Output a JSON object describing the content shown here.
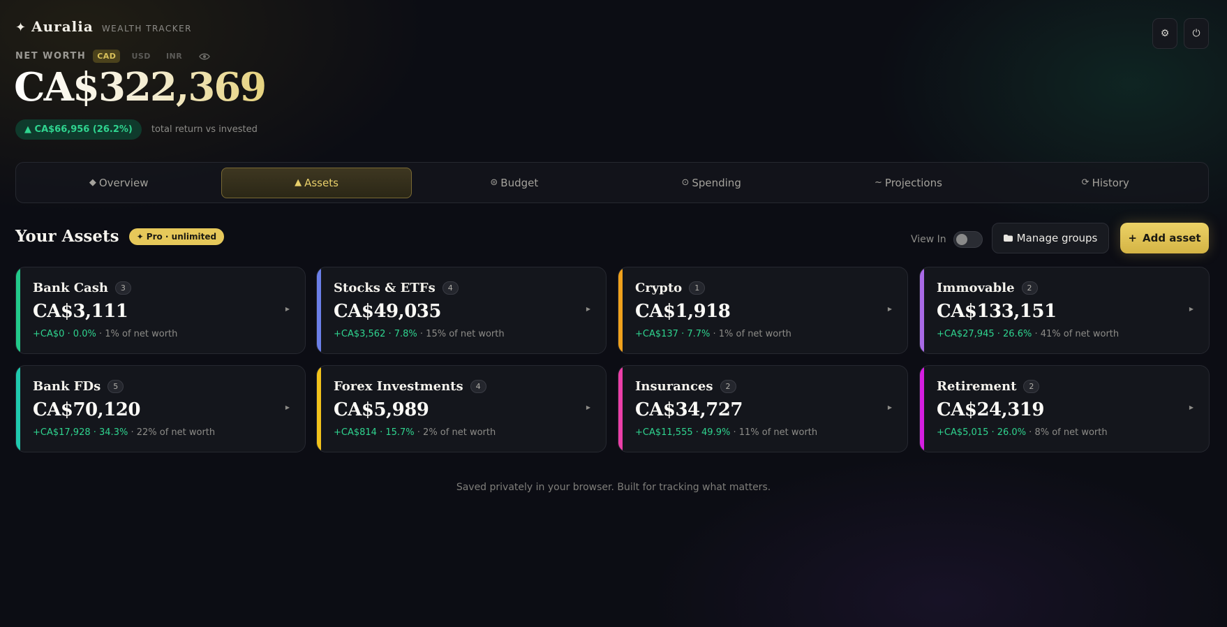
{
  "brand": {
    "star": "✦",
    "name": "Auralia",
    "tagline": "WEALTH TRACKER"
  },
  "networth": {
    "label": "NET WORTH",
    "currencies": [
      "CAD",
      "USD",
      "INR"
    ],
    "active_currency": "CAD",
    "value": "CA$322,369",
    "gain": "▲ CA$66,956 (26.2%)",
    "gain_note": "total return vs invested"
  },
  "header_icons": {
    "settings": "⚙",
    "power": "⏻"
  },
  "tabs": [
    {
      "icon": "◆",
      "label": "Overview",
      "active": false
    },
    {
      "icon": "▲",
      "label": "Assets",
      "active": true
    },
    {
      "icon": "⊜",
      "label": "Budget",
      "active": false
    },
    {
      "icon": "⊙",
      "label": "Spending",
      "active": false
    },
    {
      "icon": "~",
      "label": "Projections",
      "active": false
    },
    {
      "icon": "⟳",
      "label": "History",
      "active": false
    }
  ],
  "section": {
    "title": "Your Assets",
    "badge": "✦ Pro · unlimited",
    "view_in_label": "View In",
    "view_in_toggle": false,
    "manage_label": "Manage groups",
    "add_icon": "+",
    "add_label": "Add asset"
  },
  "assets": [
    {
      "name": "Bank Cash",
      "count": "3",
      "value": "CA$3,111",
      "gain": "+CA$0 · 0.0%",
      "share": " · 1% of net worth",
      "color": "#22c98a"
    },
    {
      "name": "Stocks & ETFs",
      "count": "4",
      "value": "CA$49,035",
      "gain": "+CA$3,562 · 7.8%",
      "share": " · 15% of net worth",
      "color": "#6b7fe8"
    },
    {
      "name": "Crypto",
      "count": "1",
      "value": "CA$1,918",
      "gain": "+CA$137 · 7.7%",
      "share": " · 1% of net worth",
      "color": "#f0a11c"
    },
    {
      "name": "Immovable",
      "count": "2",
      "value": "CA$133,151",
      "gain": "+CA$27,945 · 26.6%",
      "share": " · 41% of net worth",
      "color": "#a96ae6"
    },
    {
      "name": "Bank FDs",
      "count": "5",
      "value": "CA$70,120",
      "gain": "+CA$17,928 · 34.3%",
      "share": " · 22% of net worth",
      "color": "#1fc9ae"
    },
    {
      "name": "Forex Investments",
      "count": "4",
      "value": "CA$5,989",
      "gain": "+CA$814 · 15.7%",
      "share": " · 2% of net worth",
      "color": "#f1c21b"
    },
    {
      "name": "Insurances",
      "count": "2",
      "value": "CA$34,727",
      "gain": "+CA$11,555 · 49.9%",
      "share": " · 11% of net worth",
      "color": "#ec3fa8"
    },
    {
      "name": "Retirement",
      "count": "2",
      "value": "CA$24,319",
      "gain": "+CA$5,015 · 26.0%",
      "share": " · 8% of net worth",
      "color": "#d51ee0"
    }
  ],
  "footer": "Saved privately in your browser. Built for tracking what matters."
}
